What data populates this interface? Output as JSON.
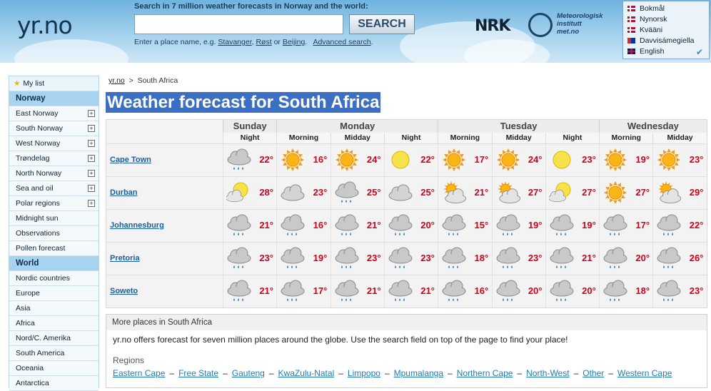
{
  "header": {
    "logo": "yr.no",
    "search_title": "Search in 7 million weather forecasts in Norway and the world:",
    "search_placeholder": "",
    "search_button": "SEARCH",
    "hint_prefix": "Enter a place name, e.g.",
    "hint_examples": [
      "Stavanger",
      "Røst",
      "Beijing"
    ],
    "hint_or": "or",
    "advanced_search": "Advanced search",
    "nrk": "NRK",
    "met_lines": [
      "Meteorologisk",
      "institutt",
      "met.no"
    ]
  },
  "languages": [
    {
      "label": "Bokmål",
      "flag": "no",
      "selected": false
    },
    {
      "label": "Nynorsk",
      "flag": "no",
      "selected": false
    },
    {
      "label": "Kvääni",
      "flag": "no",
      "selected": false
    },
    {
      "label": "Davvisámegiella",
      "flag": "sami",
      "selected": false
    },
    {
      "label": "English",
      "flag": "en",
      "selected": true
    }
  ],
  "sidebar": {
    "items": [
      {
        "label": "My list",
        "type": "mylist"
      },
      {
        "label": "Norway",
        "type": "head"
      },
      {
        "label": "East Norway",
        "type": "expand"
      },
      {
        "label": "South Norway",
        "type": "expand"
      },
      {
        "label": "West Norway",
        "type": "expand"
      },
      {
        "label": "Trøndelag",
        "type": "expand"
      },
      {
        "label": "North Norway",
        "type": "expand"
      },
      {
        "label": "Sea and oil",
        "type": "expand"
      },
      {
        "label": "Polar regions",
        "type": "expand"
      },
      {
        "label": "Midnight sun",
        "type": "link"
      },
      {
        "label": "Observations",
        "type": "link"
      },
      {
        "label": "Pollen forecast",
        "type": "link"
      },
      {
        "label": "World",
        "type": "head"
      },
      {
        "label": "Nordic countries",
        "type": "link"
      },
      {
        "label": "Europe",
        "type": "link"
      },
      {
        "label": "Asia",
        "type": "link"
      },
      {
        "label": "Africa",
        "type": "link"
      },
      {
        "label": "Nord/C. Amerika",
        "type": "link"
      },
      {
        "label": "South America",
        "type": "link"
      },
      {
        "label": "Oceania",
        "type": "link"
      },
      {
        "label": "Antarctica",
        "type": "link"
      }
    ]
  },
  "breadcrumb": {
    "home": "yr.no",
    "sep": ">",
    "current": "South Africa"
  },
  "title": "Weather forecast for South Africa",
  "forecast": {
    "days": [
      {
        "label": "Sunday",
        "periods": 1
      },
      {
        "label": "Monday",
        "periods": 3
      },
      {
        "label": "Tuesday",
        "periods": 3
      },
      {
        "label": "Wednesday",
        "periods": 2
      }
    ],
    "periods": [
      "Night",
      "Morning",
      "Midday",
      "Night",
      "Morning",
      "Midday",
      "Night",
      "Morning",
      "Midday"
    ],
    "rows": [
      {
        "place": "Cape Town",
        "cells": [
          {
            "icon": "rain-cloud-icon",
            "temp": "22°"
          },
          {
            "icon": "sun-icon",
            "temp": "16°"
          },
          {
            "icon": "sun-icon",
            "temp": "24°"
          },
          {
            "icon": "moon-icon",
            "temp": "22°"
          },
          {
            "icon": "sun-icon",
            "temp": "17°"
          },
          {
            "icon": "sun-icon",
            "temp": "24°"
          },
          {
            "icon": "moon-icon",
            "temp": "23°"
          },
          {
            "icon": "sun-icon",
            "temp": "19°"
          },
          {
            "icon": "sun-icon",
            "temp": "23°"
          }
        ]
      },
      {
        "place": "Durban",
        "cells": [
          {
            "icon": "moon-cloud-icon",
            "temp": "28°"
          },
          {
            "icon": "cloud-icon",
            "temp": "23°"
          },
          {
            "icon": "rain-cloud-icon",
            "temp": "25°"
          },
          {
            "icon": "cloud-icon",
            "temp": "25°"
          },
          {
            "icon": "sun-cloud-icon",
            "temp": "21°"
          },
          {
            "icon": "sun-cloud-icon",
            "temp": "27°"
          },
          {
            "icon": "moon-cloud-icon",
            "temp": "27°"
          },
          {
            "icon": "sun-icon",
            "temp": "27°"
          },
          {
            "icon": "sun-cloud-icon",
            "temp": "29°"
          }
        ]
      },
      {
        "place": "Johannesburg",
        "cells": [
          {
            "icon": "rain-cloud-icon",
            "temp": "21°"
          },
          {
            "icon": "rain-cloud-icon",
            "temp": "16°"
          },
          {
            "icon": "rain-cloud-icon",
            "temp": "21°"
          },
          {
            "icon": "rain-cloud-icon",
            "temp": "20°"
          },
          {
            "icon": "rain-cloud-icon",
            "temp": "15°"
          },
          {
            "icon": "rain-cloud-icon",
            "temp": "19°"
          },
          {
            "icon": "rain-cloud-icon",
            "temp": "19°"
          },
          {
            "icon": "rain-cloud-icon",
            "temp": "17°"
          },
          {
            "icon": "rain-cloud-icon",
            "temp": "22°"
          }
        ]
      },
      {
        "place": "Pretoria",
        "cells": [
          {
            "icon": "rain-cloud-icon",
            "temp": "23°"
          },
          {
            "icon": "rain-cloud-icon",
            "temp": "19°"
          },
          {
            "icon": "rain-cloud-icon",
            "temp": "23°"
          },
          {
            "icon": "rain-cloud-icon",
            "temp": "23°"
          },
          {
            "icon": "rain-cloud-icon",
            "temp": "18°"
          },
          {
            "icon": "rain-cloud-icon",
            "temp": "23°"
          },
          {
            "icon": "rain-cloud-icon",
            "temp": "21°"
          },
          {
            "icon": "rain-cloud-icon",
            "temp": "20°"
          },
          {
            "icon": "rain-cloud-icon",
            "temp": "26°"
          }
        ]
      },
      {
        "place": "Soweto",
        "cells": [
          {
            "icon": "rain-cloud-icon",
            "temp": "21°"
          },
          {
            "icon": "rain-cloud-icon",
            "temp": "17°"
          },
          {
            "icon": "rain-cloud-icon",
            "temp": "21°"
          },
          {
            "icon": "rain-cloud-icon",
            "temp": "21°"
          },
          {
            "icon": "rain-cloud-icon",
            "temp": "16°"
          },
          {
            "icon": "rain-cloud-icon",
            "temp": "20°"
          },
          {
            "icon": "rain-cloud-icon",
            "temp": "20°"
          },
          {
            "icon": "rain-cloud-icon",
            "temp": "18°"
          },
          {
            "icon": "rain-cloud-icon",
            "temp": "23°"
          }
        ]
      }
    ]
  },
  "more": {
    "title": "More places in South Africa",
    "text": "yr.no offers forecast for seven million places around the globe. Use the search field on top of the page to find your place!",
    "regions_title": "Regions",
    "separator": "–",
    "regions": [
      "Eastern Cape",
      "Free State",
      "Gauteng",
      "KwaZulu-Natal",
      "Limpopo",
      "Mpumalanga",
      "Northern Cape",
      "North-West",
      "Other",
      "Western Cape"
    ]
  },
  "colors": {
    "temp": "#d0021b",
    "link": "#1a5fa0",
    "title_bg": "#3a6fc4",
    "sidebar_head": "#a8d3ef"
  }
}
